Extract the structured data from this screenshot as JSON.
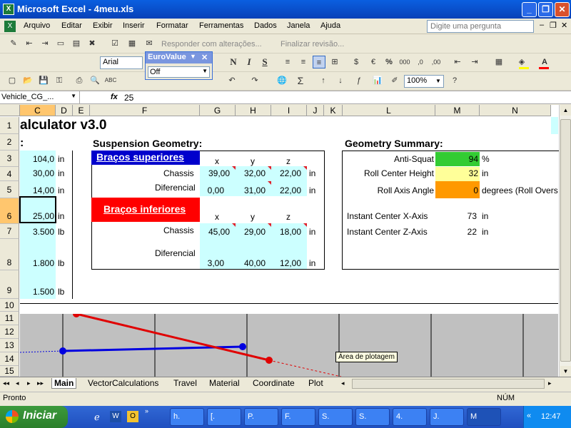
{
  "window": {
    "title": "Microsoft Excel - 4meu.xls",
    "buttons": [
      "_",
      "❐",
      "✕"
    ]
  },
  "menu": {
    "items": [
      "Arquivo",
      "Editar",
      "Exibir",
      "Inserir",
      "Formatar",
      "Ferramentas",
      "Dados",
      "Janela",
      "Ajuda"
    ],
    "help_placeholder": "Digite uma pergunta"
  },
  "toolbar": {
    "reply_label": "Responder com alterações...",
    "finish_label": "Finalizar revisão...",
    "font_name": "Arial",
    "zoom": "100%",
    "euro": {
      "title": "EuroValue",
      "value": "Off"
    }
  },
  "formula_bar": {
    "name_box": "Vehicle_CG_...",
    "fx": "fx",
    "value": "25"
  },
  "columns": [
    "C",
    "D",
    "E",
    "F",
    "G",
    "H",
    "I",
    "J",
    "K",
    "L",
    "M",
    "N"
  ],
  "rows": [
    "1",
    "2",
    "3",
    "4",
    "5",
    "6",
    "7",
    "8",
    "9",
    "10",
    "11",
    "12",
    "13",
    "14",
    "15"
  ],
  "sheet": {
    "title_fragment": "alculator v3.0",
    "colon_fragment": ":",
    "left_values": [
      {
        "value": "104,0",
        "unit": "in"
      },
      {
        "value": "30,00",
        "unit": "in"
      },
      {
        "value": "14,00",
        "unit": "in"
      },
      {
        "value": "25,00",
        "unit": "in"
      },
      {
        "value": "3.500",
        "unit": "lb"
      },
      {
        "value": "1.800",
        "unit": "lb"
      },
      {
        "value": "1.500",
        "unit": "lb"
      }
    ],
    "suspension": {
      "heading": "Suspension Geometry:",
      "upper_label": "Braços superiores",
      "lower_label": "Braços inferiores",
      "axes": [
        "x",
        "y",
        "z"
      ],
      "upper_rows": [
        {
          "label": "Chassis",
          "x": "39,00",
          "y": "32,00",
          "z": "22,00",
          "unit": "in"
        },
        {
          "label": "Diferencial",
          "x": "0,00",
          "y": "31,00",
          "z": "22,00",
          "unit": "in"
        }
      ],
      "lower_rows": [
        {
          "label": "Chassis",
          "x": "45,00",
          "y": "29,00",
          "z": "18,00",
          "unit": "in"
        },
        {
          "label": "Diferencial",
          "x": "3,00",
          "y": "40,00",
          "z": "12,00",
          "unit": "in"
        }
      ]
    },
    "summary": {
      "heading": "Geometry Summary:",
      "items": [
        {
          "label": "Anti-Squat",
          "value": "94",
          "unit": "%",
          "color": "#33cc33"
        },
        {
          "label": "Roll Center Height",
          "value": "32",
          "unit": "in",
          "color": "#ffff99"
        },
        {
          "label": "Roll Axis Angle",
          "value": "0",
          "unit": "degrees (Roll Overs",
          "color": "#ff9900"
        },
        {
          "label": "Instant Center X-Axis",
          "value": "73",
          "unit": "in",
          "color": ""
        },
        {
          "label": "Instant Center Z-Axis",
          "value": "22",
          "unit": "in",
          "color": ""
        }
      ]
    },
    "chart_tooltip": "Área de plotagem"
  },
  "tabs": {
    "items": [
      "Main",
      "VectorCalculations",
      "Travel",
      "Material",
      "Coordinate",
      "Plot"
    ],
    "active": "Main"
  },
  "status": {
    "left": "Pronto",
    "right": "NÚM"
  },
  "taskbar": {
    "start": "Iniciar",
    "items": [
      "h.",
      "[.",
      "P.",
      "F.",
      "S.",
      "S.",
      "4.",
      "J.",
      "M"
    ],
    "clock": "12:47"
  },
  "colors": {
    "upper_header": "#0000cc",
    "lower_header": "#ff0000",
    "blue_line": "#0000e0",
    "red_line": "#e00000"
  }
}
